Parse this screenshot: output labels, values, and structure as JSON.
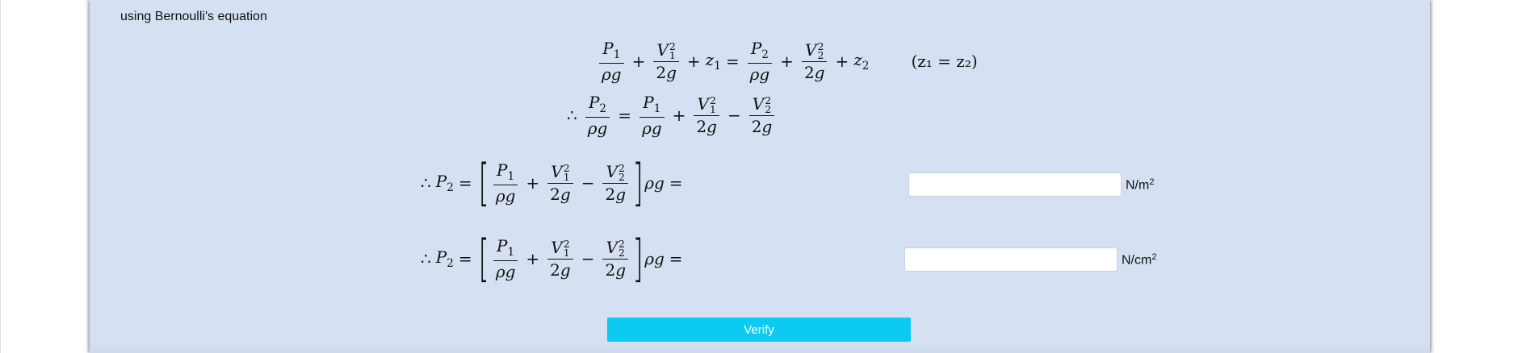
{
  "intro_text": "using Bernoulli's equation",
  "equations": {
    "eq1_condition": "(z₁ = z₂)"
  },
  "answers": [
    {
      "unit_base": "N/m",
      "unit_exp": "2",
      "value": "",
      "placeholder": ""
    },
    {
      "unit_base": "N/cm",
      "unit_exp": "2",
      "value": "",
      "placeholder": ""
    }
  ],
  "verify_label": "Verify",
  "colors": {
    "panel_bg": "#d5e1f2",
    "verify_bg": "#0dcaf0",
    "verify_text": "#ffffff"
  }
}
